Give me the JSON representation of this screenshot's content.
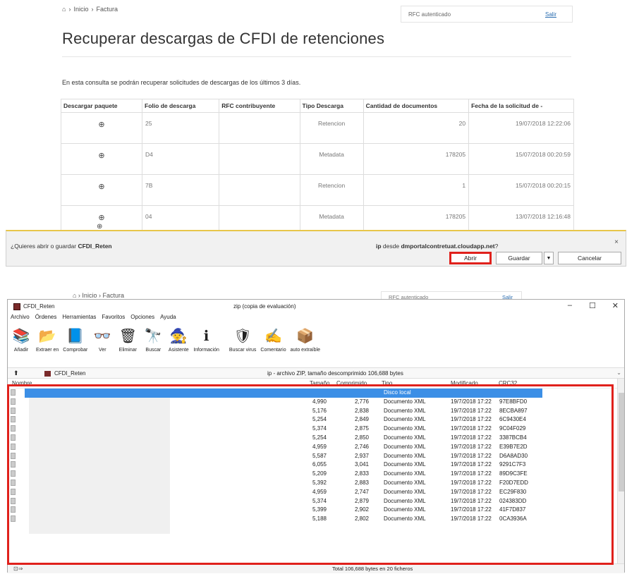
{
  "web": {
    "breadcrumb": {
      "home": "⌂",
      "sep": "›",
      "inicio": "Inicio",
      "factura": "Factura"
    },
    "rfc_box": {
      "label": "RFC autenticado",
      "logout": "Salir"
    },
    "title": "Recuperar descargas de CFDI de retenciones",
    "intro": "En esta consulta se podrán recuperar solicitudes de descargas de los últimos 3 días.",
    "table": {
      "headers": [
        "Descargar paquete",
        "Folio de descarga",
        "RFC contribuyente",
        "Tipo Descarga",
        "Cantidad de documentos",
        "Fecha de la solicitud de -"
      ],
      "rows": [
        {
          "download": "⊕",
          "folio": "25",
          "rfc": "",
          "tipo": "Retencion",
          "cantidad": "20",
          "fecha": "19/07/2018 12:22:06"
        },
        {
          "download": "⊕",
          "folio": "D4",
          "rfc": "",
          "tipo": "Metadata",
          "cantidad": "178205",
          "fecha": "15/07/2018 00:20:59"
        },
        {
          "download": "⊕",
          "folio": "7B",
          "rfc": "",
          "tipo": "Retencion",
          "cantidad": "1",
          "fecha": "15/07/2018 00:20:15"
        },
        {
          "download": "⊕",
          "folio": "04",
          "rfc": "",
          "tipo": "Metadata",
          "cantidad": "178205",
          "fecha": "13/07/2018 12:16:48"
        }
      ],
      "partial_row_download": "⊕"
    }
  },
  "download_bar": {
    "question_prefix": "¿Quieres abrir o guardar ",
    "filename": "CFDI_Reten",
    "source_prefix": "ip",
    "source_middle": " desde ",
    "source_host": "dmportalcontretuat.cloudapp.net",
    "source_suffix": "?",
    "close": "×",
    "open_button": "Abrir",
    "save_button": "Guardar",
    "save_dropdown": "▼",
    "cancel_button": "Cancelar"
  },
  "background_page": {
    "breadcrumb": "⌂ › Inicio › Factura",
    "rfc_label": "RFC autenticado",
    "logout": "Salir"
  },
  "winzip": {
    "app_name": "CFDI_Reten",
    "window_title": "zip (copia de evaluación)",
    "controls": {
      "minimize": "–",
      "maximize": "☐",
      "close": "✕"
    },
    "menu": [
      "Archivo",
      "Órdenes",
      "Herramientas",
      "Favoritos",
      "Opciones",
      "Ayuda"
    ],
    "toolbar": [
      {
        "label": "Añadir",
        "icon": "add-archive-icon",
        "glyph": "📚"
      },
      {
        "label": "Extraer en",
        "icon": "extract-icon",
        "glyph": "📂"
      },
      {
        "label": "Comprobar",
        "icon": "test-icon",
        "glyph": "📘"
      },
      {
        "label": "Ver",
        "icon": "view-icon",
        "glyph": "👓"
      },
      {
        "label": "Eliminar",
        "icon": "delete-icon",
        "glyph": "🗑"
      },
      {
        "label": "Buscar",
        "icon": "find-icon",
        "glyph": "🔭"
      },
      {
        "label": "Asistente",
        "icon": "wizard-icon",
        "glyph": "🧙"
      },
      {
        "label": "Información",
        "icon": "info-icon",
        "glyph": "ℹ"
      },
      {
        "label": "Buscar virus",
        "icon": "virus-scan-icon",
        "glyph": "🛡"
      },
      {
        "label": "Comentario",
        "icon": "comment-icon",
        "glyph": "✍"
      },
      {
        "label": "auto extraíble",
        "icon": "sfx-icon",
        "glyph": "📦"
      }
    ],
    "address": {
      "up": "⬆",
      "path": "CFDI_Reten",
      "info": "ip - archivo ZIP, tamaño descomprimido 106,688 bytes",
      "chevron": "⌄"
    },
    "columns": [
      "Nombre",
      "Tamaño",
      "Comprimido",
      "Tipo",
      "Modificado",
      "CRC32"
    ],
    "selected_row_tipo": "Disco local",
    "files": [
      {
        "size": "4,990",
        "packed": "2,776",
        "tipo": "Documento XML",
        "mod": "19/7/2018 17:22",
        "crc": "97E8BFD0"
      },
      {
        "size": "5,176",
        "packed": "2,838",
        "tipo": "Documento XML",
        "mod": "19/7/2018 17:22",
        "crc": "8ECBA897"
      },
      {
        "size": "5,254",
        "packed": "2,849",
        "tipo": "Documento XML",
        "mod": "19/7/2018 17:22",
        "crc": "6C9430E4"
      },
      {
        "size": "5,374",
        "packed": "2,875",
        "tipo": "Documento XML",
        "mod": "19/7/2018 17:22",
        "crc": "9C04F029"
      },
      {
        "size": "5,254",
        "packed": "2,850",
        "tipo": "Documento XML",
        "mod": "19/7/2018 17:22",
        "crc": "3387BCB4"
      },
      {
        "size": "4,959",
        "packed": "2,746",
        "tipo": "Documento XML",
        "mod": "19/7/2018 17:22",
        "crc": "E39B7E2D"
      },
      {
        "size": "5,587",
        "packed": "2,937",
        "tipo": "Documento XML",
        "mod": "19/7/2018 17:22",
        "crc": "D6A8AD30"
      },
      {
        "size": "6,055",
        "packed": "3,041",
        "tipo": "Documento XML",
        "mod": "19/7/2018 17:22",
        "crc": "9291C7F3"
      },
      {
        "size": "5,209",
        "packed": "2,833",
        "tipo": "Documento XML",
        "mod": "19/7/2018 17:22",
        "crc": "89D9C3FE"
      },
      {
        "size": "5,392",
        "packed": "2,883",
        "tipo": "Documento XML",
        "mod": "19/7/2018 17:22",
        "crc": "F20D7EDD"
      },
      {
        "size": "4,959",
        "packed": "2,747",
        "tipo": "Documento XML",
        "mod": "19/7/2018 17:22",
        "crc": "EC29F830"
      },
      {
        "size": "5,374",
        "packed": "2,879",
        "tipo": "Documento XML",
        "mod": "19/7/2018 17:22",
        "crc": "024383DD"
      },
      {
        "size": "5,399",
        "packed": "2,902",
        "tipo": "Documento XML",
        "mod": "19/7/2018 17:22",
        "crc": "41F7D837"
      },
      {
        "size": "5,188",
        "packed": "2,802",
        "tipo": "Documento XML",
        "mod": "19/7/2018 17:22",
        "crc": "0CA3936A"
      }
    ],
    "status": {
      "icon": "⊡⇒",
      "text": "Total 106,688 bytes en 20 ficheros"
    }
  },
  "colors": {
    "highlight_red": "#e0211c",
    "selection_blue": "#3c8fe6",
    "link_blue": "#2a6db0"
  }
}
